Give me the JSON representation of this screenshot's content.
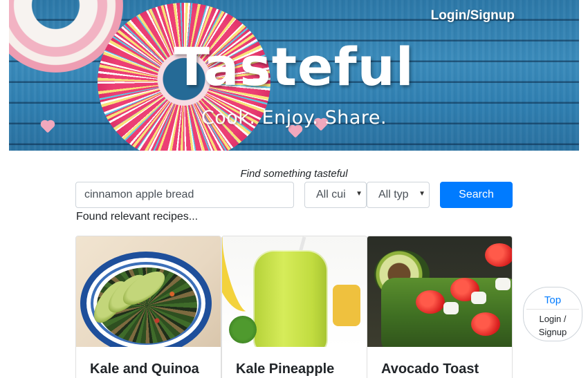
{
  "header": {
    "brand": "Tasteful",
    "tagline": "Cook. Enjoy. Share.",
    "login_label": "Login/Signup"
  },
  "search": {
    "heading": "Find something tasteful",
    "query_value": "cinnamon apple bread",
    "cuisine_selected": "All cui",
    "type_selected": "All typ",
    "button_label": "Search",
    "result_text": "Found relevant recipes..."
  },
  "recipes": [
    {
      "title": "Kale and Quinoa"
    },
    {
      "title": "Kale Pineapple"
    },
    {
      "title": "Avocado Toast"
    }
  ],
  "float_nav": {
    "top_label": "Top",
    "login_label": "Login / Signup"
  },
  "colors": {
    "primary": "#007bff",
    "hero_blue": "#2f7fb1"
  },
  "icons": {
    "select_caret": "caret-down-icon"
  }
}
